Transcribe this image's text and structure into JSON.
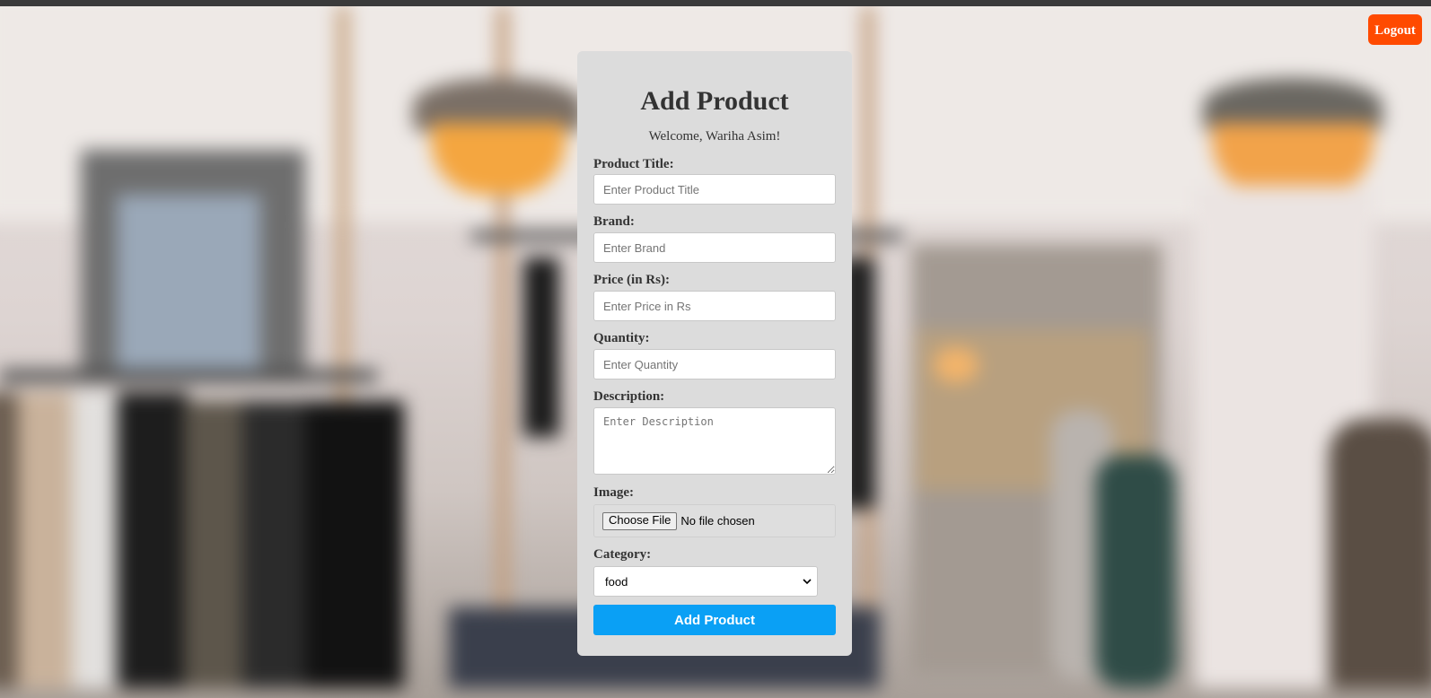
{
  "header": {
    "logout_label": "Logout"
  },
  "form": {
    "title": "Add Product",
    "welcome": "Welcome, Wariha Asim!",
    "fields": {
      "title": {
        "label": "Product Title:",
        "placeholder": "Enter Product Title"
      },
      "brand": {
        "label": "Brand:",
        "placeholder": "Enter Brand"
      },
      "price": {
        "label": "Price (in Rs):",
        "placeholder": "Enter Price in Rs"
      },
      "quantity": {
        "label": "Quantity:",
        "placeholder": "Enter Quantity"
      },
      "description": {
        "label": "Description:",
        "placeholder": "Enter Description"
      },
      "image": {
        "label": "Image:",
        "button_label": "Choose File",
        "status": "No file chosen"
      },
      "category": {
        "label": "Category:",
        "selected": "food"
      }
    },
    "submit_label": "Add Product"
  },
  "colors": {
    "logout": "#ff4a00",
    "submit": "#0aa0f5",
    "card": "#dcdcdc"
  },
  "icons": [
    "chevron-down-icon"
  ]
}
